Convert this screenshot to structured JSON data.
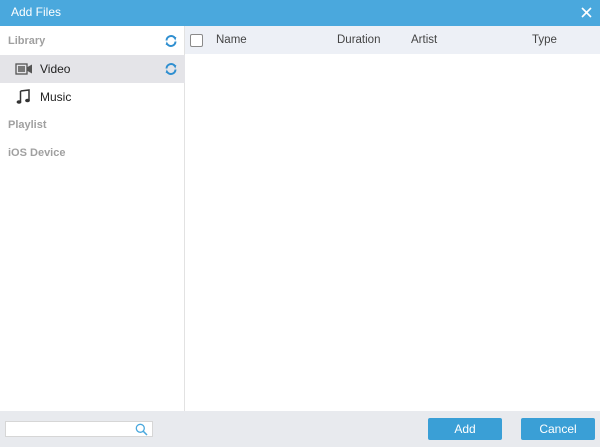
{
  "window": {
    "title": "Add Files",
    "close_icon": "close-icon"
  },
  "sidebar": {
    "library_header": "Library",
    "items": [
      {
        "label": "Video",
        "icon": "video-camera-icon",
        "selected": true
      },
      {
        "label": "Music",
        "icon": "music-note-icon",
        "selected": false
      }
    ],
    "playlist_header": "Playlist",
    "ios_header": "iOS Device"
  },
  "table": {
    "columns": [
      "Name",
      "Duration",
      "Artist",
      "Type"
    ],
    "rows": []
  },
  "footer": {
    "search_placeholder": "",
    "add_label": "Add",
    "cancel_label": "Cancel"
  },
  "colors": {
    "accent": "#4aa8dd",
    "button": "#3a9fd6",
    "refresh_icon": "#2f8fd0",
    "selected_row": "#e4e4e8",
    "header_bg": "#edf0f6"
  }
}
